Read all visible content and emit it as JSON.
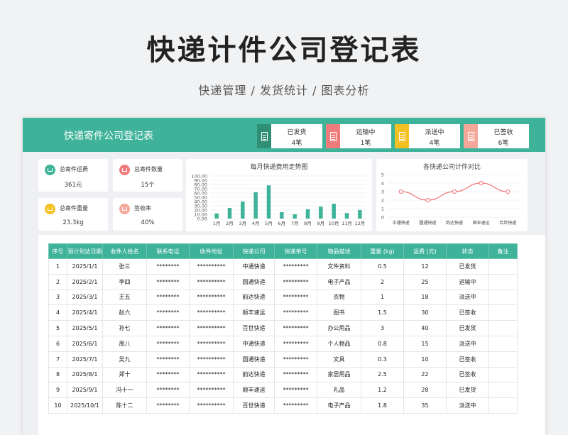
{
  "header": {
    "title": "快递计件公司登记表",
    "subtitle": "快递管理 / 发货统计  / 图表分析"
  },
  "banner": {
    "title": "快递寄件公司登记表"
  },
  "status_cards": [
    {
      "label": "已发货",
      "value": "4笔",
      "color": "#2e8f74"
    },
    {
      "label": "运输中",
      "value": "1笔",
      "color": "#f07b7b"
    },
    {
      "label": "派送中",
      "value": "4笔",
      "color": "#f4c123"
    },
    {
      "label": "已签收",
      "value": "6笔",
      "color": "#f5a89a"
    }
  ],
  "kpis": [
    {
      "label": "总寄件运费",
      "value": "361元",
      "color": "#3fb39a"
    },
    {
      "label": "总寄件数量",
      "value": "15个",
      "color": "#f07b7b"
    },
    {
      "label": "总寄件重量",
      "value": "23.3kg",
      "color": "#f4c123"
    },
    {
      "label": "签收率",
      "value": "40%",
      "color": "#f5a89a"
    }
  ],
  "chart_data": [
    {
      "type": "bar",
      "title": "每月快递费用走势图",
      "categories": [
        "1月",
        "2月",
        "3月",
        "4月",
        "5月",
        "6月",
        "7月",
        "8月",
        "9月",
        "10月",
        "11月",
        "12月"
      ],
      "values": [
        12,
        25,
        40,
        62,
        78,
        15,
        10,
        22,
        28,
        35,
        13,
        20
      ],
      "yticks": [
        "0.00",
        "10.00",
        "20.00",
        "30.00",
        "40.00",
        "50.00",
        "60.00",
        "70.00",
        "80.00",
        "90.00",
        "100.00"
      ],
      "ylim": [
        0,
        100
      ],
      "color": "#3fb39a",
      "grid": true
    },
    {
      "type": "line",
      "title": "各快递公司计件对比",
      "categories": [
        "中通快递",
        "圆通快递",
        "韵达快递",
        "顺丰速运",
        "百世快递"
      ],
      "values": [
        3,
        2,
        3,
        4,
        3
      ],
      "yticks": [
        "0",
        "1",
        "2",
        "3",
        "4",
        "5"
      ],
      "ylim": [
        0,
        5
      ],
      "color": "#f07b7b",
      "grid": true
    }
  ],
  "table": {
    "columns": [
      "序号",
      "预计到达日期",
      "收件人姓名",
      "联系电话",
      "收件地址",
      "快递公司",
      "快递单号",
      "物品描述",
      "重量 (kg)",
      "运费 (元)",
      "状态",
      "备注"
    ],
    "rows": [
      [
        "1",
        "2025/1/1",
        "张三",
        "********",
        "**********",
        "中通快递",
        "*********",
        "文件资料",
        "0.5",
        "12",
        "已发货",
        ""
      ],
      [
        "2",
        "2025/2/1",
        "李四",
        "********",
        "**********",
        "圆通快递",
        "*********",
        "电子产品",
        "2",
        "25",
        "运输中",
        ""
      ],
      [
        "3",
        "2025/3/1",
        "王五",
        "********",
        "**********",
        "韵达快递",
        "*********",
        "衣物",
        "1",
        "18",
        "派送中",
        ""
      ],
      [
        "4",
        "2025/4/1",
        "赵六",
        "********",
        "**********",
        "顺丰速运",
        "*********",
        "图书",
        "1.5",
        "30",
        "已签收",
        ""
      ],
      [
        "5",
        "2025/5/1",
        "孙七",
        "********",
        "**********",
        "百世快递",
        "*********",
        "办公用品",
        "3",
        "40",
        "已发货",
        ""
      ],
      [
        "6",
        "2025/6/1",
        "周八",
        "********",
        "**********",
        "中通快递",
        "*********",
        "个人物品",
        "0.8",
        "15",
        "派送中",
        ""
      ],
      [
        "7",
        "2025/7/1",
        "吴九",
        "********",
        "**********",
        "圆通快递",
        "*********",
        "文具",
        "0.3",
        "10",
        "已签收",
        ""
      ],
      [
        "8",
        "2025/8/1",
        "郑十",
        "********",
        "**********",
        "韵达快递",
        "*********",
        "家居用品",
        "2.5",
        "22",
        "已签收",
        ""
      ],
      [
        "9",
        "2025/9/1",
        "冯十一",
        "********",
        "**********",
        "顺丰速运",
        "*********",
        "礼品",
        "1.2",
        "28",
        "已发货",
        ""
      ],
      [
        "10",
        "2025/10/1",
        "陈十二",
        "********",
        "**********",
        "百世快递",
        "*********",
        "电子产品",
        "1.8",
        "35",
        "派送中",
        ""
      ]
    ]
  }
}
